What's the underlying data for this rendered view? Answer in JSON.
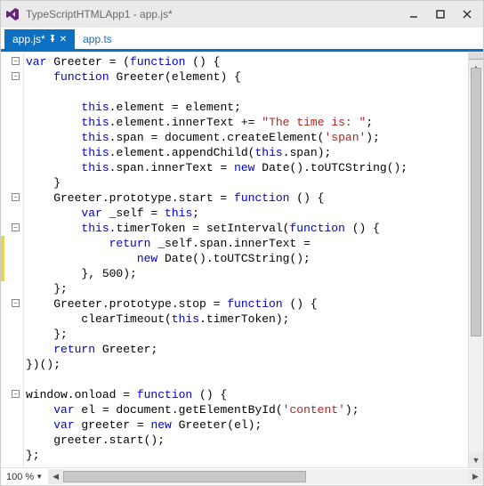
{
  "window": {
    "title": "TypeScriptHTMLApp1 - app.js*"
  },
  "tabs": {
    "active": {
      "label": "app.js*"
    },
    "inactive": {
      "label": "app.ts"
    }
  },
  "status": {
    "zoom": "100 %"
  },
  "code": {
    "lines": [
      {
        "tokens": [
          {
            "c": "k",
            "t": "var"
          },
          {
            "c": "t",
            "t": " Greeter = ("
          },
          {
            "c": "k",
            "t": "function"
          },
          {
            "c": "t",
            "t": " () {"
          }
        ]
      },
      {
        "tokens": [
          {
            "c": "t",
            "t": "    "
          },
          {
            "c": "k",
            "t": "function"
          },
          {
            "c": "t",
            "t": " Greeter(element) {"
          }
        ]
      },
      {
        "tokens": [
          {
            "c": "t",
            "t": " "
          }
        ]
      },
      {
        "tokens": [
          {
            "c": "t",
            "t": "        "
          },
          {
            "c": "k",
            "t": "this"
          },
          {
            "c": "t",
            "t": ".element = element;"
          }
        ]
      },
      {
        "tokens": [
          {
            "c": "t",
            "t": "        "
          },
          {
            "c": "k",
            "t": "this"
          },
          {
            "c": "t",
            "t": ".element.innerText += "
          },
          {
            "c": "s",
            "t": "\"The time is: \""
          },
          {
            "c": "t",
            "t": ";"
          }
        ]
      },
      {
        "tokens": [
          {
            "c": "t",
            "t": "        "
          },
          {
            "c": "k",
            "t": "this"
          },
          {
            "c": "t",
            "t": ".span = document.createElement("
          },
          {
            "c": "s",
            "t": "'span'"
          },
          {
            "c": "t",
            "t": ");"
          }
        ]
      },
      {
        "tokens": [
          {
            "c": "t",
            "t": "        "
          },
          {
            "c": "k",
            "t": "this"
          },
          {
            "c": "t",
            "t": ".element.appendChild("
          },
          {
            "c": "k",
            "t": "this"
          },
          {
            "c": "t",
            "t": ".span);"
          }
        ]
      },
      {
        "tokens": [
          {
            "c": "t",
            "t": "        "
          },
          {
            "c": "k",
            "t": "this"
          },
          {
            "c": "t",
            "t": ".span.innerText = "
          },
          {
            "c": "k",
            "t": "new"
          },
          {
            "c": "t",
            "t": " Date().toUTCString();"
          }
        ]
      },
      {
        "tokens": [
          {
            "c": "t",
            "t": "    }"
          }
        ]
      },
      {
        "tokens": [
          {
            "c": "t",
            "t": "    Greeter.prototype.start = "
          },
          {
            "c": "k",
            "t": "function"
          },
          {
            "c": "t",
            "t": " () {"
          }
        ]
      },
      {
        "tokens": [
          {
            "c": "t",
            "t": "        "
          },
          {
            "c": "k",
            "t": "var"
          },
          {
            "c": "t",
            "t": " _self = "
          },
          {
            "c": "k",
            "t": "this"
          },
          {
            "c": "t",
            "t": ";"
          }
        ]
      },
      {
        "tokens": [
          {
            "c": "t",
            "t": "        "
          },
          {
            "c": "k",
            "t": "this"
          },
          {
            "c": "t",
            "t": ".timerToken = setInterval("
          },
          {
            "c": "k",
            "t": "function"
          },
          {
            "c": "t",
            "t": " () {"
          }
        ]
      },
      {
        "tokens": [
          {
            "c": "t",
            "t": "            "
          },
          {
            "c": "k",
            "t": "return"
          },
          {
            "c": "t",
            "t": " _self.span.innerText ="
          }
        ]
      },
      {
        "tokens": [
          {
            "c": "t",
            "t": "                "
          },
          {
            "c": "k",
            "t": "new"
          },
          {
            "c": "t",
            "t": " Date().toUTCString();"
          }
        ]
      },
      {
        "tokens": [
          {
            "c": "t",
            "t": "        }, 500);"
          }
        ]
      },
      {
        "tokens": [
          {
            "c": "t",
            "t": "    };"
          }
        ]
      },
      {
        "tokens": [
          {
            "c": "t",
            "t": "    Greeter.prototype.stop = "
          },
          {
            "c": "k",
            "t": "function"
          },
          {
            "c": "t",
            "t": " () {"
          }
        ]
      },
      {
        "tokens": [
          {
            "c": "t",
            "t": "        clearTimeout("
          },
          {
            "c": "k",
            "t": "this"
          },
          {
            "c": "t",
            "t": ".timerToken);"
          }
        ]
      },
      {
        "tokens": [
          {
            "c": "t",
            "t": "    };"
          }
        ]
      },
      {
        "tokens": [
          {
            "c": "t",
            "t": "    "
          },
          {
            "c": "k",
            "t": "return"
          },
          {
            "c": "t",
            "t": " Greeter;"
          }
        ]
      },
      {
        "tokens": [
          {
            "c": "t",
            "t": "})();"
          }
        ]
      },
      {
        "tokens": [
          {
            "c": "t",
            "t": " "
          }
        ]
      },
      {
        "tokens": [
          {
            "c": "t",
            "t": "window.onload = "
          },
          {
            "c": "k",
            "t": "function"
          },
          {
            "c": "t",
            "t": " () {"
          }
        ]
      },
      {
        "tokens": [
          {
            "c": "t",
            "t": "    "
          },
          {
            "c": "k",
            "t": "var"
          },
          {
            "c": "t",
            "t": " el = document.getElementById("
          },
          {
            "c": "s",
            "t": "'content'"
          },
          {
            "c": "t",
            "t": ");"
          }
        ]
      },
      {
        "tokens": [
          {
            "c": "t",
            "t": "    "
          },
          {
            "c": "k",
            "t": "var"
          },
          {
            "c": "t",
            "t": " greeter = "
          },
          {
            "c": "k",
            "t": "new"
          },
          {
            "c": "t",
            "t": " Greeter(el);"
          }
        ]
      },
      {
        "tokens": [
          {
            "c": "t",
            "t": "    greeter.start();"
          }
        ]
      },
      {
        "tokens": [
          {
            "c": "t",
            "t": "};"
          }
        ]
      }
    ],
    "folds": [
      0,
      1,
      9,
      11,
      16,
      22
    ],
    "changeMarker": {
      "fromLine": 12,
      "toLine": 15
    }
  }
}
